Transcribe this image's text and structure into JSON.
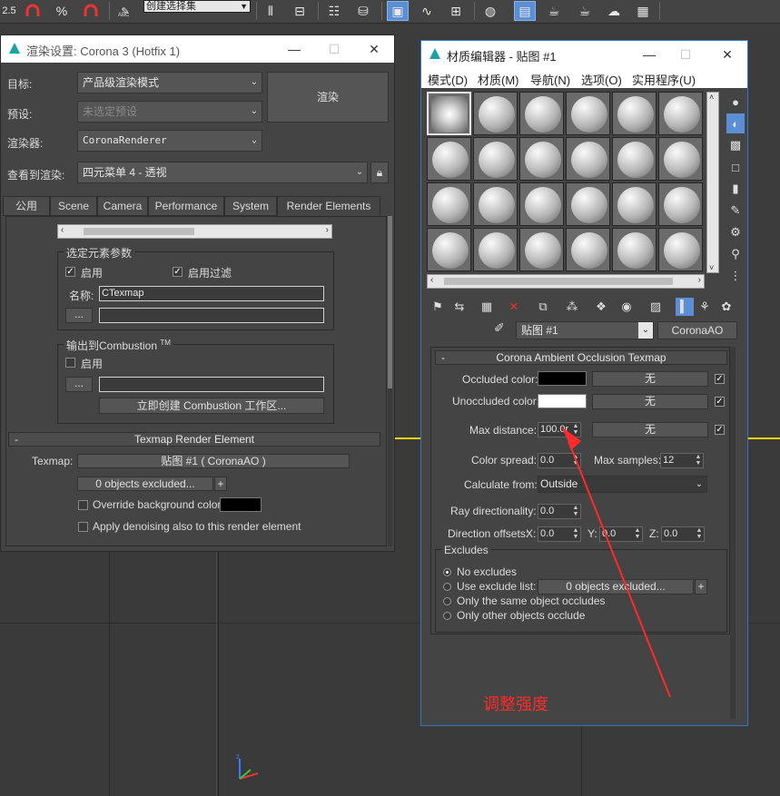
{
  "toolbar": {
    "selection_set": "创建选择集",
    "buttons": [
      "snap-2-5d-icon",
      "angle-snap-icon",
      "percent-snap-icon",
      "spinner-snap-icon",
      "edit-named-sets-icon",
      "mirror-icon",
      "align-icon",
      "layer-manager-icon",
      "scene-explorer-icon",
      "curve-editor-icon",
      "schematic-view-icon",
      "material-editor-icon",
      "render-setup-icon",
      "rendered-frame-icon",
      "render-icon",
      "render-cloud-icon",
      "render-teapot-icon",
      "render-setup-2-icon"
    ],
    "text_labels": {
      "abc": "ABC",
      "snap_num": "2.5"
    }
  },
  "render_dialog": {
    "title": "渲染设置: Corona 3 (Hotfix 1)",
    "target_label": "目标:",
    "target_value": "产品级渲染模式",
    "preset_label": "预设:",
    "preset_value": "未选定预设",
    "renderer_label": "渲染器:",
    "renderer_value": "CoronaRenderer",
    "view_label": "查看到渲染:",
    "view_value": "四元菜单 4 - 透视",
    "render_button": "渲染",
    "tabs": [
      "公用",
      "Scene",
      "Camera",
      "Performance",
      "System",
      "Render Elements"
    ],
    "selected_params_title": "选定元素参数",
    "enable_label": "启用",
    "enable_filter_label": "启用过滤",
    "name_label": "名称:",
    "name_value": "CTexmap",
    "browse_label": "...",
    "combustion_title": "输出到Combustion",
    "combustion_tm": "TM",
    "combustion_enable": "启用",
    "create_combustion_button": "立即创建 Combustion 工作区...",
    "texmap_rollout_title": "Texmap Render Element",
    "rollout_minus": "-",
    "texmap_label": "Texmap:",
    "texmap_value": "贴图 #1 ( CoronaAO )",
    "objects_excluded": "0 objects excluded...",
    "plus": "+",
    "override_bg_label": "Override background color:",
    "denoise_label": "Apply denoising also to this render element",
    "colors": {
      "override_bg": "#000000"
    }
  },
  "material_editor": {
    "title": "材质编辑器 - 贴图 #1",
    "menu": [
      "模式(D)",
      "材质(M)",
      "导航(N)",
      "选项(O)",
      "实用程序(U)"
    ],
    "slot_rows": 4,
    "slot_cols": 6,
    "map_name": "贴图 #1",
    "map_type": "CoronaAO",
    "rollout_title": "Corona Ambient Occlusion Texmap",
    "rollout_minus": "-",
    "occluded_label": "Occluded color:",
    "unoccluded_label": "Unoccluded color:",
    "max_distance_label": "Max distance:",
    "max_distance_value": "100.0r",
    "none_label": "无",
    "color_spread_label": "Color spread:",
    "color_spread_value": "0.0",
    "max_samples_label": "Max samples:",
    "max_samples_value": "12",
    "calculate_from_label": "Calculate from:",
    "calculate_from_value": "Outside",
    "ray_dir_label": "Ray directionality:",
    "ray_dir_value": "0.0",
    "dir_offsets_label": "Direction offsets:",
    "x_label": "X:",
    "y_label": "Y:",
    "z_label": "Z:",
    "x_value": "0.0",
    "y_value": "0.0",
    "z_value": "0.0",
    "excludes_title": "Excludes",
    "no_excludes": "No excludes",
    "use_exclude_list": "Use exclude list:",
    "excluded_button": "0 objects excluded...",
    "plus": "+",
    "same_object": "Only the same object occludes",
    "other_objects": "Only other objects occlude",
    "colors": {
      "occluded": "#000000",
      "unoccluded": "#ffffff"
    }
  },
  "annotation": {
    "text": "调整强度",
    "color": "#ff2a2a"
  },
  "window_buttons": {
    "minimize": "—",
    "maximize": "☐",
    "close": "✕"
  }
}
